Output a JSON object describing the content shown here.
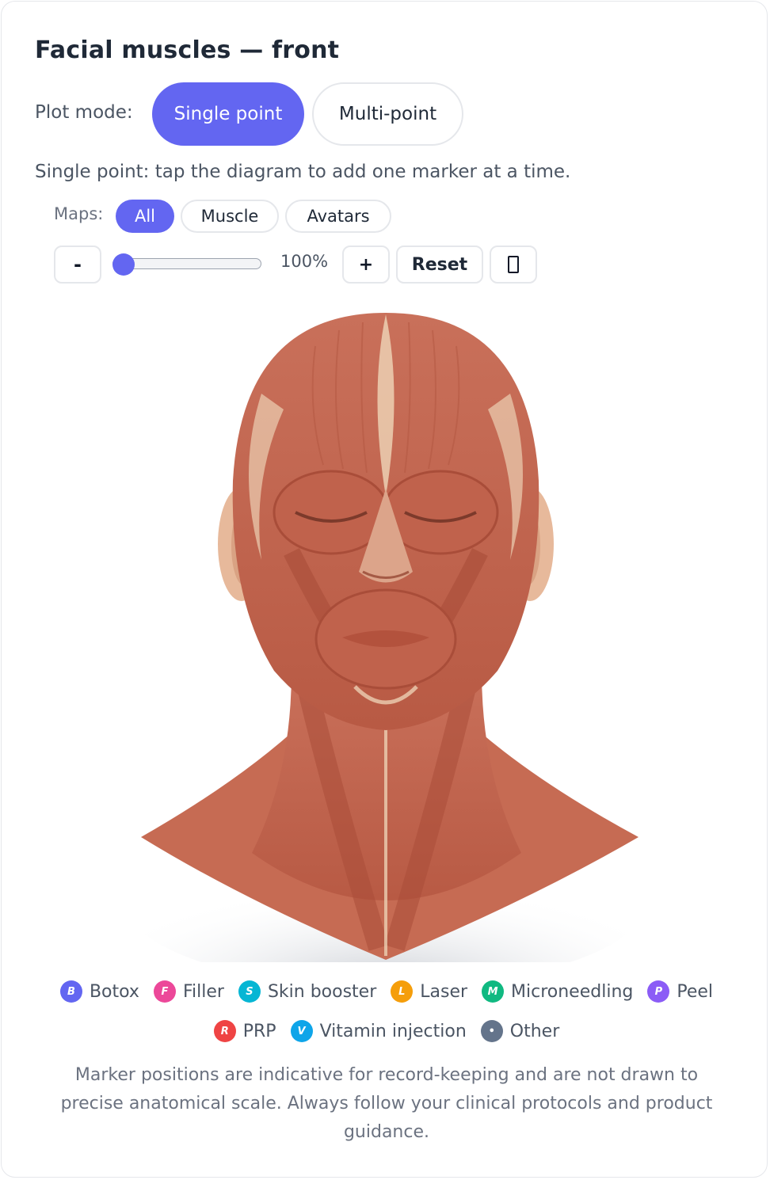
{
  "title": "Facial muscles — front",
  "plot_mode": {
    "label": "Plot mode:",
    "options": [
      "Single point",
      "Multi-point"
    ],
    "selected": "Single point"
  },
  "hint": "Single point: tap the diagram to add one marker at a time.",
  "maps": {
    "label": "Maps:",
    "options": [
      "All",
      "Muscle",
      "Avatars"
    ],
    "selected": "All"
  },
  "zoom": {
    "minus_label": "-",
    "plus_label": "+",
    "value_text": "100%",
    "value_fraction": 0.0,
    "reset_label": "Reset",
    "fullscreen_icon": "fullscreen-icon"
  },
  "diagram": {
    "subject": "facial-muscles-front",
    "colors": {
      "muscle": "#c86a52",
      "tendon": "#ecd0b3",
      "skin_shadow": "#9ca3af"
    }
  },
  "legend": [
    {
      "letter": "B",
      "label": "Botox",
      "color": "#6366f1"
    },
    {
      "letter": "F",
      "label": "Filler",
      "color": "#ec4899"
    },
    {
      "letter": "S",
      "label": "Skin booster",
      "color": "#06b6d4"
    },
    {
      "letter": "L",
      "label": "Laser",
      "color": "#f59e0b"
    },
    {
      "letter": "M",
      "label": "Microneedling",
      "color": "#10b981"
    },
    {
      "letter": "P",
      "label": "Peel",
      "color": "#8b5cf6"
    },
    {
      "letter": "R",
      "label": "PRP",
      "color": "#ef4444"
    },
    {
      "letter": "V",
      "label": "Vitamin injection",
      "color": "#0ea5e9"
    },
    {
      "letter": "•",
      "label": "Other",
      "color": "#64748b"
    }
  ],
  "disclaimer": "Marker positions are indicative for record-keeping and are not drawn to precise anatomical scale. Always follow your clinical protocols and product guidance."
}
